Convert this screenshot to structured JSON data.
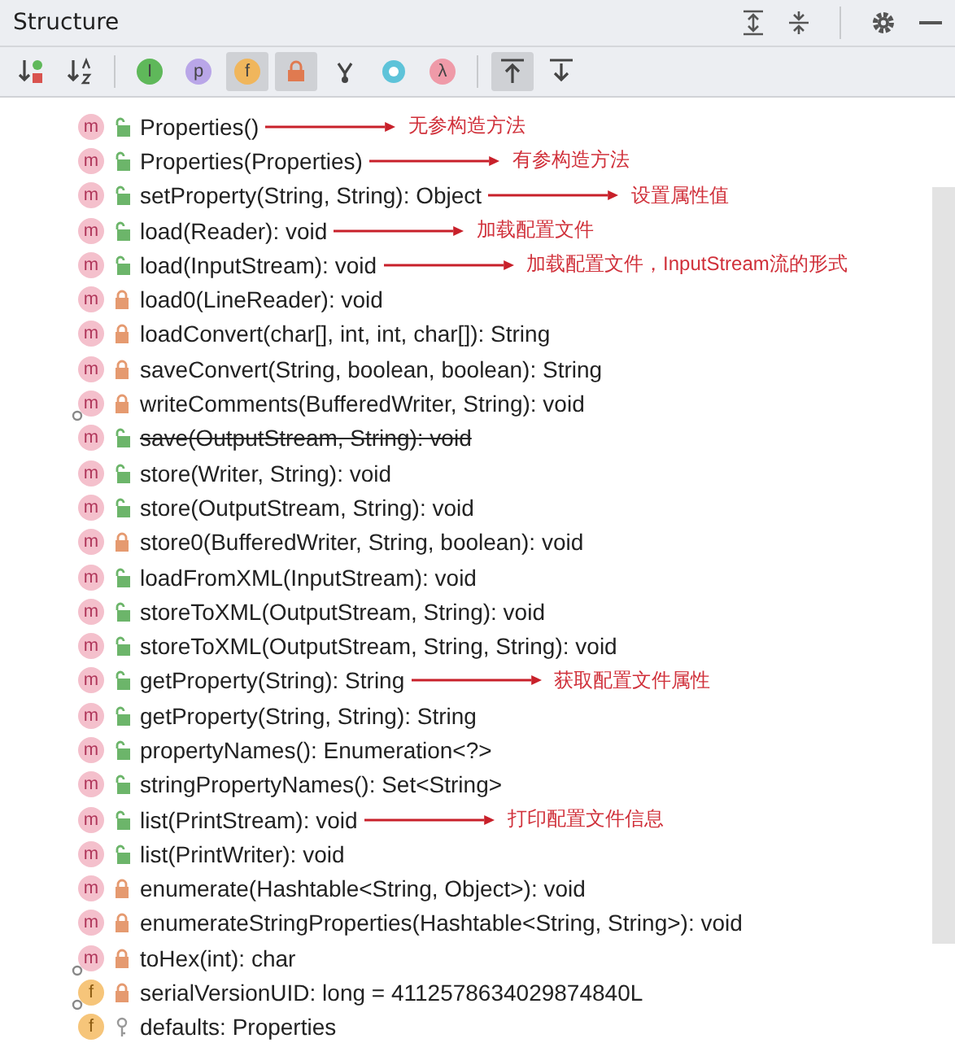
{
  "panel": {
    "title": "Structure"
  },
  "toolbar": [
    {
      "kind": "sort-visibility",
      "selected": false
    },
    {
      "kind": "sort-alpha",
      "selected": false
    },
    {
      "kind": "letter",
      "glyph": "I",
      "color": "#5fb85a",
      "selected": false
    },
    {
      "kind": "letter",
      "glyph": "p",
      "color": "#b9a6e8",
      "selected": false
    },
    {
      "kind": "letter",
      "glyph": "f",
      "color": "#f0b65c",
      "selected": true
    },
    {
      "kind": "lock",
      "selected": true
    },
    {
      "kind": "fork",
      "selected": false
    },
    {
      "kind": "ring",
      "selected": false
    },
    {
      "kind": "letter",
      "glyph": "λ",
      "color": "#ef9aa8",
      "selected": false
    },
    {
      "kind": "scroll-to",
      "selected": true
    },
    {
      "kind": "scroll-from",
      "selected": false
    }
  ],
  "members": [
    {
      "kind": "method-public",
      "badge": "m",
      "deprecated": false,
      "overlay": false,
      "text": "Properties()",
      "note": "无参构造方法"
    },
    {
      "kind": "method-public",
      "badge": "m",
      "deprecated": false,
      "overlay": false,
      "text": "Properties(Properties)",
      "note": "有参构造方法"
    },
    {
      "kind": "method-public",
      "badge": "m",
      "deprecated": false,
      "overlay": false,
      "text": "setProperty(String, String): Object",
      "note": "设置属性值"
    },
    {
      "kind": "method-public",
      "badge": "m",
      "deprecated": false,
      "overlay": false,
      "text": "load(Reader): void",
      "note": "加载配置文件"
    },
    {
      "kind": "method-public",
      "badge": "m",
      "deprecated": false,
      "overlay": false,
      "text": "load(InputStream): void",
      "note": "加载配置文件，InputStream流的形式"
    },
    {
      "kind": "method-private",
      "badge": "m",
      "deprecated": false,
      "overlay": false,
      "text": "load0(LineReader): void"
    },
    {
      "kind": "method-private",
      "badge": "m",
      "deprecated": false,
      "overlay": false,
      "text": "loadConvert(char[], int, int, char[]): String"
    },
    {
      "kind": "method-private",
      "badge": "m",
      "deprecated": false,
      "overlay": false,
      "text": "saveConvert(String, boolean, boolean): String"
    },
    {
      "kind": "method-private",
      "badge": "m",
      "deprecated": false,
      "overlay": true,
      "text": "writeComments(BufferedWriter, String): void"
    },
    {
      "kind": "method-public",
      "badge": "m",
      "deprecated": true,
      "overlay": false,
      "text": "save(OutputStream, String): void"
    },
    {
      "kind": "method-public",
      "badge": "m",
      "deprecated": false,
      "overlay": false,
      "text": "store(Writer, String): void"
    },
    {
      "kind": "method-public",
      "badge": "m",
      "deprecated": false,
      "overlay": false,
      "text": "store(OutputStream, String): void"
    },
    {
      "kind": "method-private",
      "badge": "m",
      "deprecated": false,
      "overlay": false,
      "text": "store0(BufferedWriter, String, boolean): void"
    },
    {
      "kind": "method-public",
      "badge": "m",
      "deprecated": false,
      "overlay": false,
      "text": "loadFromXML(InputStream): void"
    },
    {
      "kind": "method-public",
      "badge": "m",
      "deprecated": false,
      "overlay": false,
      "text": "storeToXML(OutputStream, String): void"
    },
    {
      "kind": "method-public",
      "badge": "m",
      "deprecated": false,
      "overlay": false,
      "text": "storeToXML(OutputStream, String, String): void"
    },
    {
      "kind": "method-public",
      "badge": "m",
      "deprecated": false,
      "overlay": false,
      "text": "getProperty(String): String",
      "note": "获取配置文件属性"
    },
    {
      "kind": "method-public",
      "badge": "m",
      "deprecated": false,
      "overlay": false,
      "text": "getProperty(String, String): String"
    },
    {
      "kind": "method-public",
      "badge": "m",
      "deprecated": false,
      "overlay": false,
      "text": "propertyNames(): Enumeration<?>"
    },
    {
      "kind": "method-public",
      "badge": "m",
      "deprecated": false,
      "overlay": false,
      "text": "stringPropertyNames(): Set<String>"
    },
    {
      "kind": "method-public",
      "badge": "m",
      "deprecated": false,
      "overlay": false,
      "text": "list(PrintStream): void",
      "note": "打印配置文件信息"
    },
    {
      "kind": "method-public",
      "badge": "m",
      "deprecated": false,
      "overlay": false,
      "text": "list(PrintWriter): void"
    },
    {
      "kind": "method-private",
      "badge": "m",
      "deprecated": false,
      "overlay": false,
      "text": "enumerate(Hashtable<String, Object>): void"
    },
    {
      "kind": "method-private",
      "badge": "m",
      "deprecated": false,
      "overlay": false,
      "text": "enumerateStringProperties(Hashtable<String, String>): void"
    },
    {
      "kind": "method-private",
      "badge": "m",
      "deprecated": false,
      "overlay": true,
      "text": "toHex(int): char"
    },
    {
      "kind": "field-private",
      "badge": "f",
      "deprecated": false,
      "overlay": true,
      "text": "serialVersionUID: long = 4112578634029874840L"
    },
    {
      "kind": "field-package",
      "badge": "f",
      "deprecated": false,
      "overlay": false,
      "text": "defaults: Properties"
    }
  ]
}
